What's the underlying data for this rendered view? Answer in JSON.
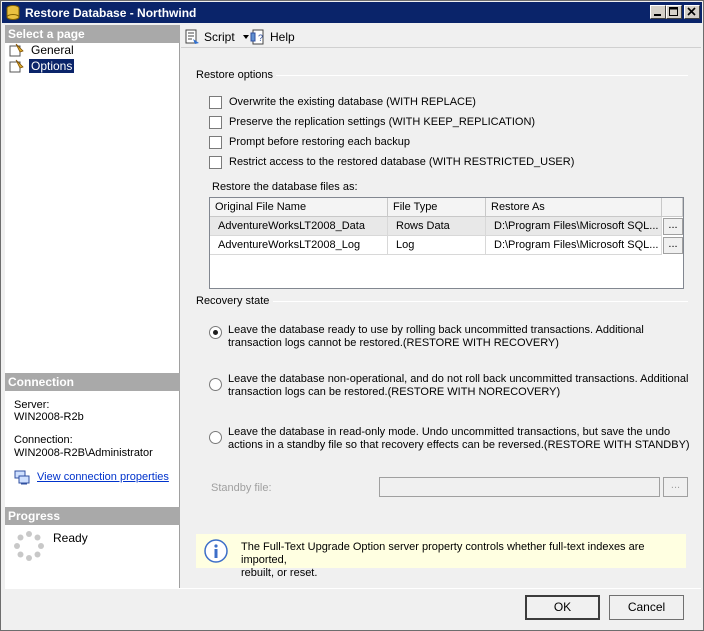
{
  "window": {
    "title": "Restore Database - Northwind"
  },
  "left_panel": {
    "select_page_header": "Select a page",
    "pages": [
      {
        "label": "General",
        "icon": "page-icon"
      },
      {
        "label": "Options",
        "icon": "page-icon",
        "selected": true
      }
    ],
    "connection_header": "Connection",
    "server_label": "Server:",
    "server_value": "WIN2008-R2b",
    "connection_label": "Connection:",
    "connection_value": "WIN2008-R2B\\Administrator",
    "view_connection_link": "View connection properties",
    "progress_header": "Progress",
    "progress_status": "Ready"
  },
  "toolbar": {
    "script_label": "Script",
    "help_label": "Help"
  },
  "restore_options": {
    "group_label": "Restore options",
    "checkboxes": [
      {
        "label": "Overwrite the existing database (WITH REPLACE)",
        "checked": false
      },
      {
        "label": "Preserve the replication settings (WITH KEEP_REPLICATION)",
        "checked": false
      },
      {
        "label": "Prompt before restoring each backup",
        "checked": false
      },
      {
        "label": "Restrict access to the restored database (WITH RESTRICTED_USER)",
        "checked": false
      }
    ],
    "files_label": "Restore the database files as:",
    "grid_columns": [
      "Original File Name",
      "File Type",
      "Restore As"
    ],
    "grid_rows": [
      {
        "original": "AdventureWorksLT2008_Data",
        "type": "Rows Data",
        "restore_as": "D:\\Program Files\\Microsoft SQL...",
        "button": "..."
      },
      {
        "original": "AdventureWorksLT2008_Log",
        "type": "Log",
        "restore_as": "D:\\Program Files\\Microsoft SQL...",
        "button": "..."
      }
    ]
  },
  "recovery_state": {
    "group_label": "Recovery state",
    "options": [
      {
        "line1": "Leave the database ready to use by rolling back uncommitted transactions. Additional",
        "line2": "transaction logs cannot be restored.(RESTORE WITH RECOVERY)",
        "selected": true
      },
      {
        "line1": "Leave the database non-operational, and do not roll back uncommitted transactions. Additional",
        "line2": "transaction logs can be restored.(RESTORE WITH NORECOVERY)",
        "selected": false
      },
      {
        "line1": "Leave the database in read-only mode. Undo uncommitted transactions, but save the undo",
        "line2": "actions in a standby file so that recovery effects can be reversed.(RESTORE WITH STANDBY)",
        "selected": false
      }
    ],
    "standby_label": "Standby file:",
    "standby_value": "",
    "standby_button": "..."
  },
  "notice": {
    "line1": "The Full-Text Upgrade Option server property controls whether full-text indexes are imported,",
    "line2": "rebuilt, or reset."
  },
  "buttons": {
    "ok": "OK",
    "cancel": "Cancel"
  }
}
